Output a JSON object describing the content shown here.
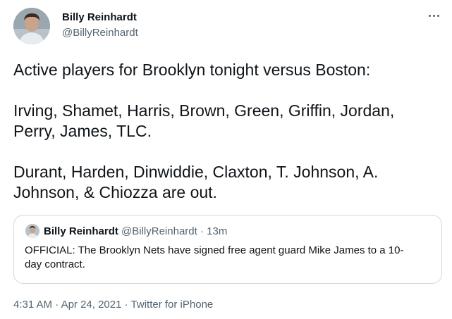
{
  "author": {
    "display_name": "Billy Reinhardt",
    "handle": "@BillyReinhardt"
  },
  "more_icon": "more-horizontal-icon",
  "tweet": {
    "lines": [
      "Active players for Brooklyn tonight versus Boston:",
      "Irving, Shamet, Harris, Brown, Green, Griffin, Jordan,",
      "Perry, James, TLC.",
      "Durant, Harden, Dinwiddie, Claxton, T. Johnson, A.",
      "Johnson, & Chiozza are out."
    ]
  },
  "quote": {
    "display_name": "Billy Reinhardt",
    "handle": "@BillyReinhardt",
    "separator": " · ",
    "time": "13m",
    "text_lines": [
      "OFFICIAL: The Brooklyn Nets have signed free agent guard Mike James to a 10-",
      "day contract."
    ]
  },
  "meta": {
    "time": "4:31 AM",
    "dot1": " · ",
    "date": "Apr 24, 2021",
    "dot2": " · ",
    "source": "Twitter for iPhone"
  },
  "colors": {
    "text_primary": "#0f1419",
    "text_secondary": "#536471",
    "border": "#cfd9de"
  }
}
